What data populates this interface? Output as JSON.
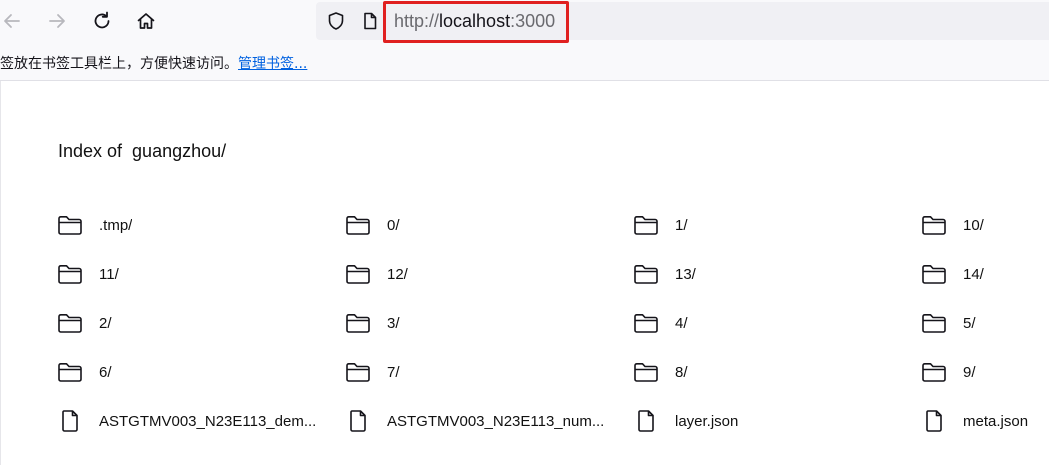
{
  "browser": {
    "back_icon": "arrow-left-icon",
    "forward_icon": "arrow-right-icon",
    "reload_icon": "reload-icon",
    "home_icon": "home-icon",
    "shield_icon": "shield-icon",
    "page_icon": "page-icon",
    "url": {
      "scheme": "http://",
      "host": "localhost",
      "port": ":3000"
    },
    "highlight_color": "#e02020"
  },
  "bookmarks_bar": {
    "message": "签放在书签工具栏上，方便快速访问。",
    "manage_link": "管理书签..."
  },
  "listing": {
    "heading": "Index of  guangzhou/",
    "entries": [
      {
        "name": ".tmp/",
        "type": "folder"
      },
      {
        "name": "0/",
        "type": "folder"
      },
      {
        "name": "1/",
        "type": "folder"
      },
      {
        "name": "10/",
        "type": "folder"
      },
      {
        "name": "11/",
        "type": "folder"
      },
      {
        "name": "12/",
        "type": "folder"
      },
      {
        "name": "13/",
        "type": "folder"
      },
      {
        "name": "14/",
        "type": "folder"
      },
      {
        "name": "2/",
        "type": "folder"
      },
      {
        "name": "3/",
        "type": "folder"
      },
      {
        "name": "4/",
        "type": "folder"
      },
      {
        "name": "5/",
        "type": "folder"
      },
      {
        "name": "6/",
        "type": "folder"
      },
      {
        "name": "7/",
        "type": "folder"
      },
      {
        "name": "8/",
        "type": "folder"
      },
      {
        "name": "9/",
        "type": "folder"
      },
      {
        "name": "ASTGTMV003_N23E113_dem...",
        "type": "file"
      },
      {
        "name": "ASTGTMV003_N23E113_num...",
        "type": "file"
      },
      {
        "name": "layer.json",
        "type": "file"
      },
      {
        "name": "meta.json",
        "type": "file"
      }
    ]
  }
}
